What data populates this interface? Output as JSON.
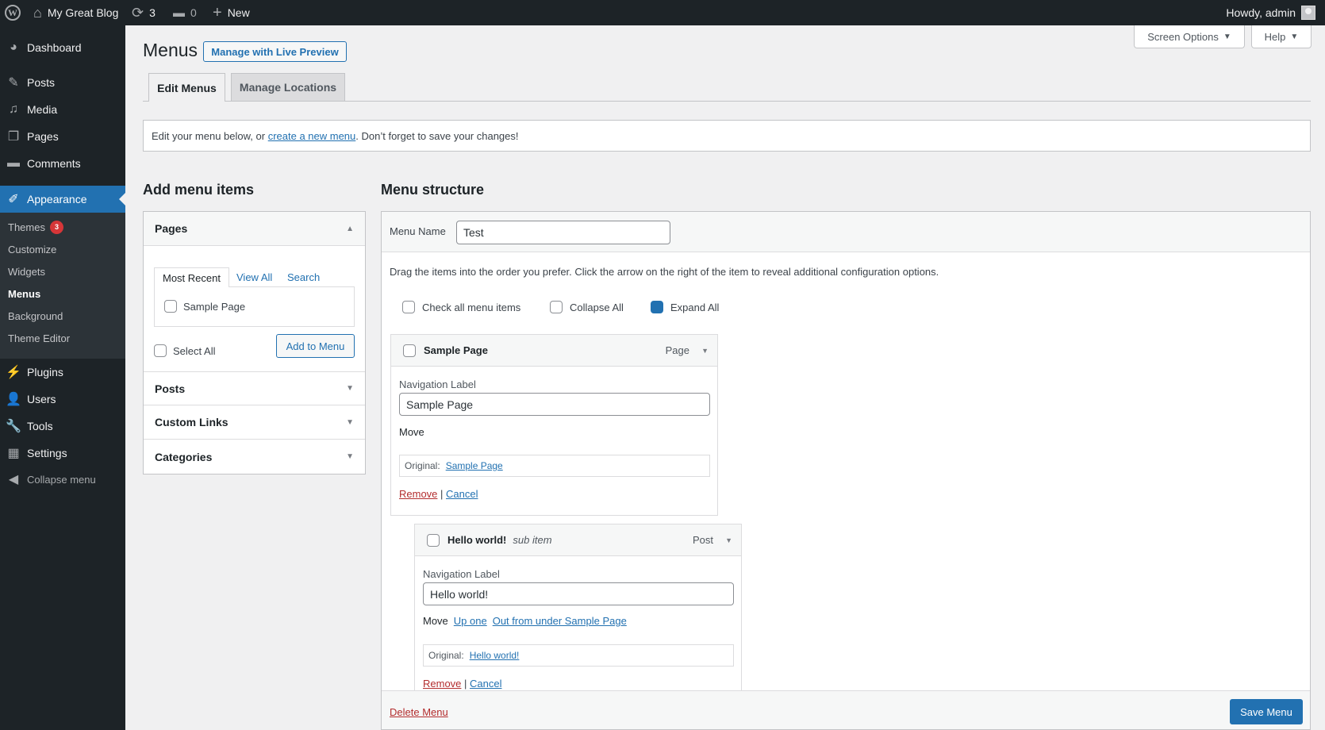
{
  "adminbar": {
    "site_name": "My Great Blog",
    "updates_count": "3",
    "comments_count": "0",
    "new_label": "New",
    "howdy": "Howdy, admin",
    "icons": {
      "logo": "wordpress-icon",
      "home": "home-icon",
      "updates": "refresh-icon",
      "comments": "comment-icon",
      "new": "plus-icon",
      "avatar": "avatar-icon"
    }
  },
  "sidebar": {
    "items": [
      {
        "label": "Dashboard",
        "icon": "dashboard-icon"
      },
      {
        "label": "Posts",
        "icon": "pin-icon"
      },
      {
        "label": "Media",
        "icon": "media-icon"
      },
      {
        "label": "Pages",
        "icon": "pages-icon"
      },
      {
        "label": "Comments",
        "icon": "comment-icon"
      },
      {
        "label": "Appearance",
        "icon": "paintbrush-icon",
        "active": true
      },
      {
        "label": "Plugins",
        "icon": "plugin-icon"
      },
      {
        "label": "Users",
        "icon": "users-icon"
      },
      {
        "label": "Tools",
        "icon": "wrench-icon"
      },
      {
        "label": "Settings",
        "icon": "settings-icon"
      },
      {
        "label": "Collapse menu",
        "icon": "collapse-icon"
      }
    ],
    "submenu": [
      {
        "label": "Themes",
        "badge": "3"
      },
      {
        "label": "Customize"
      },
      {
        "label": "Widgets"
      },
      {
        "label": "Menus",
        "current": true
      },
      {
        "label": "Background"
      },
      {
        "label": "Theme Editor"
      }
    ]
  },
  "header": {
    "title": "Menus",
    "live_preview": "Manage with Live Preview",
    "screen_options": "Screen Options",
    "help": "Help",
    "tabs": [
      {
        "label": "Edit Menus",
        "active": true
      },
      {
        "label": "Manage Locations"
      }
    ]
  },
  "notice": {
    "prefix": "Edit your menu below, or ",
    "link": "create a new menu",
    "suffix": ". Don’t forget to save your changes!"
  },
  "add_items": {
    "heading": "Add menu items",
    "sections": [
      {
        "label": "Pages",
        "expanded": true
      },
      {
        "label": "Posts"
      },
      {
        "label": "Custom Links"
      },
      {
        "label": "Categories"
      }
    ],
    "pages_tabs": [
      "Most Recent",
      "View All",
      "Search"
    ],
    "pages_list": [
      "Sample Page"
    ],
    "select_all": "Select All",
    "add_button": "Add to Menu"
  },
  "menu_structure": {
    "heading": "Menu Structure",
    "menu_name_label": "Menu Name",
    "menu_name_value": "Test",
    "instructions": "Drag the items into the order you prefer. Click the arrow on the right of the item to reveal additional configuration options.",
    "bulk": [
      {
        "label": "Check all menu items",
        "checked": false
      },
      {
        "label": "Collapse All",
        "checked": false
      },
      {
        "label": "Expand All",
        "checked": true
      }
    ],
    "items": [
      {
        "title": "Sample Page",
        "subtitle": "",
        "type": "Page",
        "nav_label_caption": "Navigation Label",
        "nav_label_value": "Sample Page",
        "move_label": "Move",
        "move_links": [],
        "original_label": "Original:",
        "original_link": "Sample Page",
        "remove": "Remove",
        "cancel": "Cancel"
      },
      {
        "title": "Hello world!",
        "subtitle": "sub item",
        "type": "Post",
        "nav_label_caption": "Navigation Label",
        "nav_label_value": "Hello world!",
        "move_label": "Move",
        "move_links": [
          "Up one",
          "Out from under Sample Page"
        ],
        "original_label": "Original:",
        "original_link": "Hello world!",
        "remove": "Remove",
        "cancel": "Cancel"
      }
    ],
    "delete_menu": "Delete Menu",
    "save_menu": "Save Menu"
  },
  "colors": {
    "accent": "#2271b1",
    "danger": "#b32d2e",
    "adminbar": "#1d2327",
    "badge": "#d63638"
  }
}
